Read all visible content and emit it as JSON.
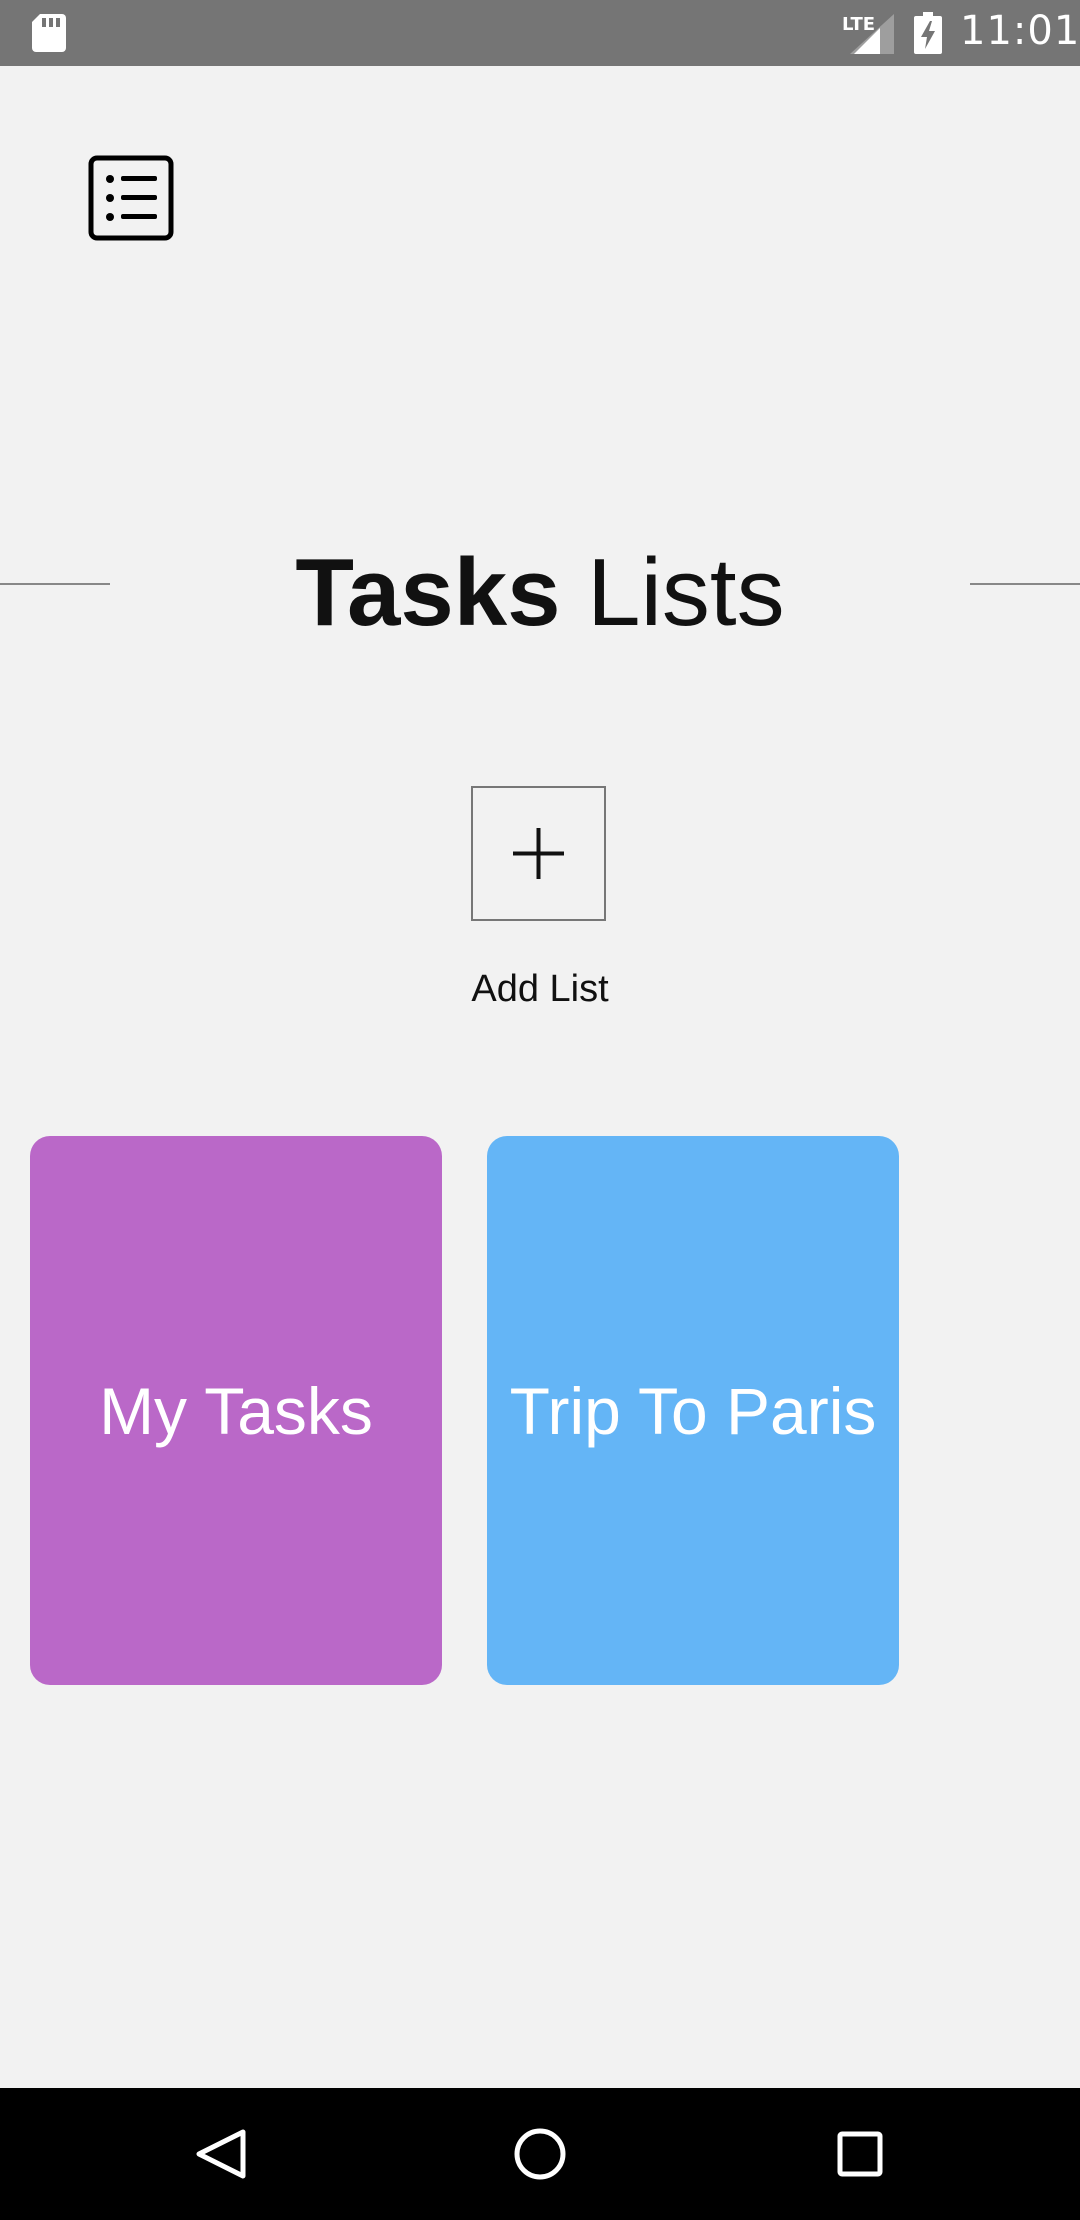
{
  "status_bar": {
    "network_label": "LTE",
    "time": "11:01",
    "background": "#757575"
  },
  "header": {
    "menu_icon": "list-icon",
    "title_bold": "Tasks",
    "title_regular": "Lists"
  },
  "add_list": {
    "icon": "plus-icon",
    "label": "Add List"
  },
  "lists": [
    {
      "name": "My Tasks",
      "color": "#ba68c8"
    },
    {
      "name": "Trip To Paris",
      "color": "#64b5f6"
    }
  ],
  "nav_bar": {
    "icons": [
      "back-icon",
      "home-icon",
      "recent-apps-icon"
    ]
  },
  "colors": {
    "background": "#f2f2f2",
    "text": "#111111"
  }
}
